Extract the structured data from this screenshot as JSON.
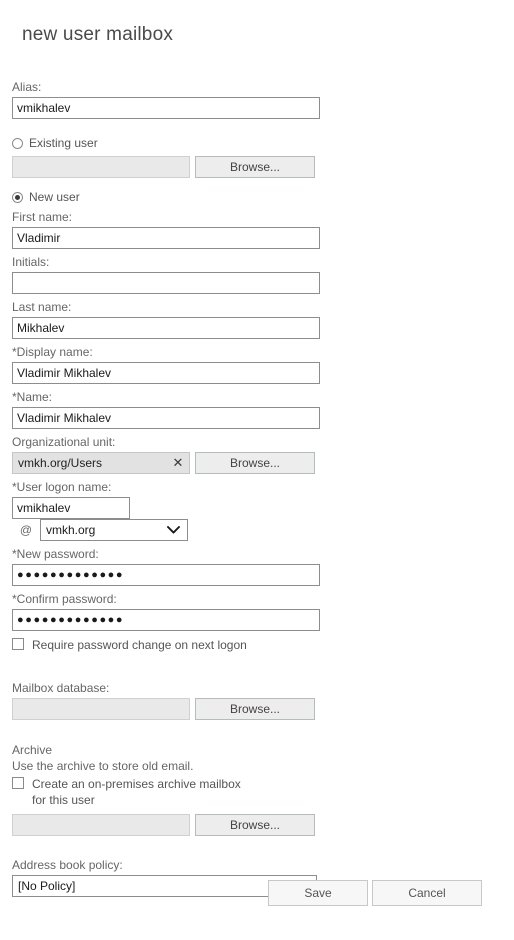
{
  "dialog": {
    "title": "new user mailbox"
  },
  "fields": {
    "alias": {
      "label": "Alias:",
      "value": "vmikhalev"
    },
    "existing_user": {
      "radio_label": "Existing user",
      "selected": false,
      "value": "",
      "browse_label": "Browse..."
    },
    "new_user": {
      "radio_label": "New user",
      "selected": true
    },
    "first_name": {
      "label": "First name:",
      "value": "Vladimir"
    },
    "initials": {
      "label": "Initials:",
      "value": ""
    },
    "last_name": {
      "label": "Last name:",
      "value": "Mikhalev"
    },
    "display_name": {
      "label": "*Display name:",
      "value": "Vladimir Mikhalev"
    },
    "name": {
      "label": "*Name:",
      "value": "Vladimir Mikhalev"
    },
    "organizational_unit": {
      "label": "Organizational unit:",
      "value": "vmkh.org/Users",
      "clear_glyph": "✕",
      "browse_label": "Browse..."
    },
    "user_logon_name": {
      "label": "*User logon name:",
      "value": "vmikhalev",
      "at_symbol": "@",
      "domain_value": "vmkh.org"
    },
    "new_password": {
      "label": "*New password:",
      "value": "●●●●●●●●●●●●●"
    },
    "confirm_password": {
      "label": "*Confirm password:",
      "value": "●●●●●●●●●●●●●"
    },
    "require_password_change": {
      "label": "Require password change on next logon",
      "checked": false
    },
    "mailbox_database": {
      "label": "Mailbox database:",
      "value": "",
      "browse_label": "Browse..."
    },
    "archive": {
      "section_title": "Archive",
      "description": "Use the archive to store old email.",
      "checkbox_label": "Create an on-premises archive mailbox for this user",
      "checked": false,
      "value": "",
      "browse_label": "Browse..."
    },
    "address_book_policy": {
      "label": "Address book policy:",
      "value": "[No Policy]"
    }
  },
  "footer": {
    "save_label": "Save",
    "cancel_label": "Cancel"
  }
}
